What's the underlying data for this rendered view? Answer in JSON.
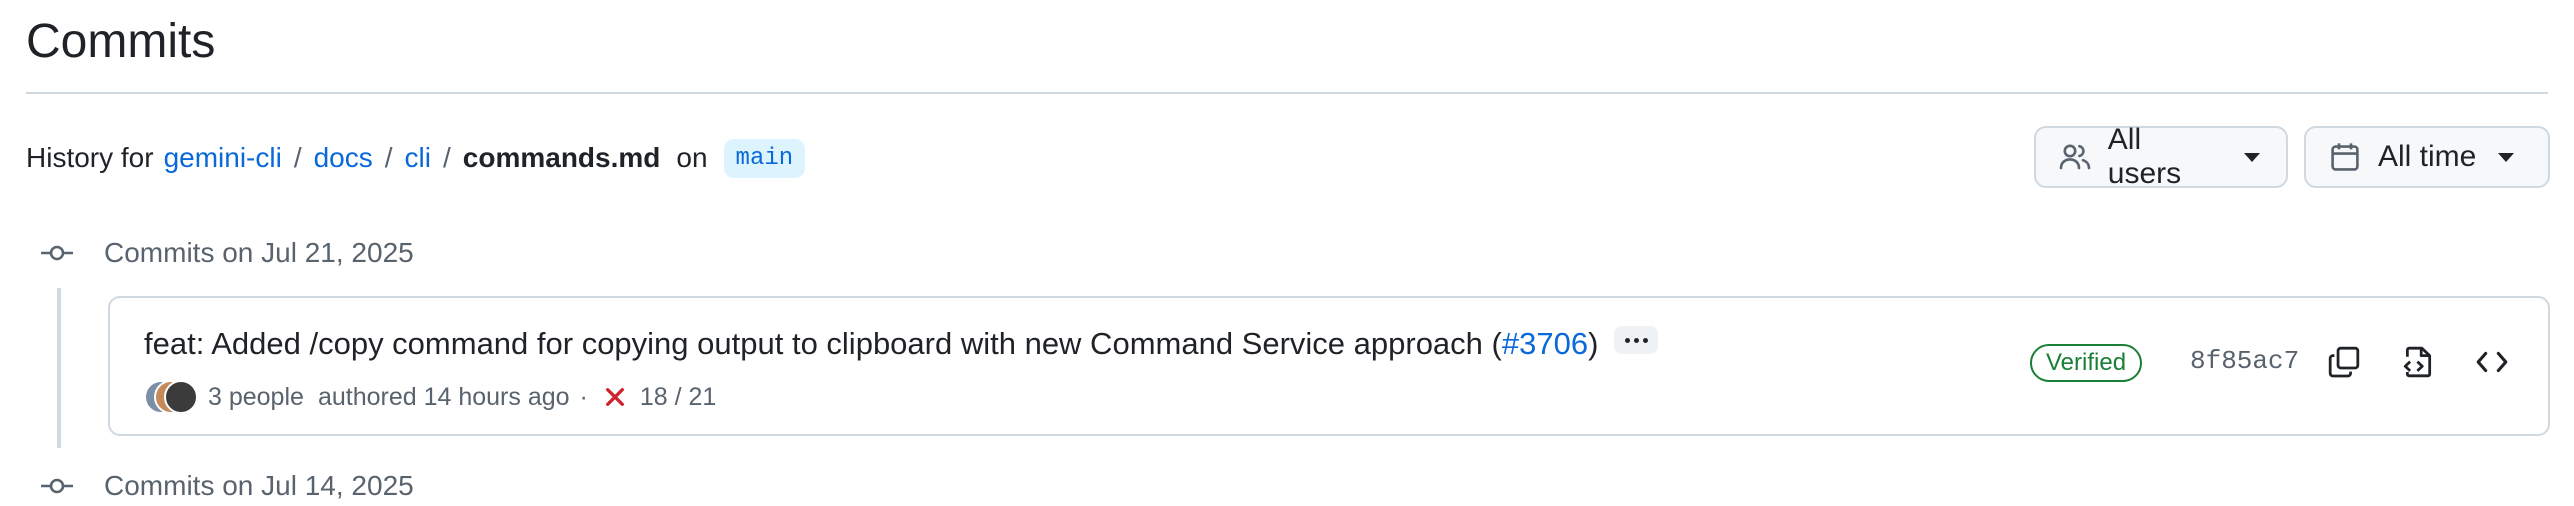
{
  "page": {
    "title": "Commits"
  },
  "history": {
    "prefix": "History for",
    "path": [
      "gemini-cli",
      "docs",
      "cli"
    ],
    "separator": "/",
    "file": "commands.md",
    "on": "on",
    "branch": "main"
  },
  "filters": {
    "users_label": "All users",
    "users_icon": "people-icon",
    "time_label": "All time",
    "time_icon": "calendar-icon"
  },
  "groups": [
    {
      "label": "Commits on Jul 21, 2025",
      "icon": "git-commit-icon"
    },
    {
      "label": "Commits on Jul 14, 2025",
      "icon": "git-commit-icon"
    }
  ],
  "commits": [
    {
      "message": "feat: Added /copy command for copying output to clipboard with new Command Service approach (",
      "pr": "#3706",
      "message_end": ")",
      "authors": "3 people",
      "authored": "authored 14 hours ago",
      "dot": "·",
      "checks": "18 / 21",
      "checks_status": "failed",
      "verified": "Verified",
      "sha": "8f85ac7"
    }
  ],
  "colors": {
    "link": "#0969da",
    "verified": "#1a7f37",
    "fail": "#cf222e",
    "muted": "#59636e",
    "border": "#d1d9e0"
  }
}
